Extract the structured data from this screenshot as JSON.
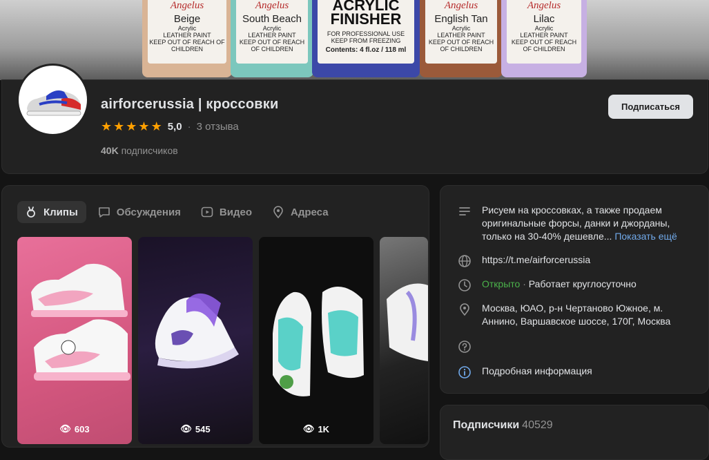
{
  "cover": {
    "bottles": [
      {
        "brand": "Angelus",
        "name": "Beige",
        "sub1": "Acrylic",
        "sub2": "LEATHER PAINT",
        "sub3": "KEEP OUT OF REACH OF CHILDREN",
        "color": "#d9b495"
      },
      {
        "brand": "Angelus",
        "name": "South Beach",
        "sub1": "Acrylic",
        "sub2": "LEATHER PAINT",
        "sub3": "KEEP OUT OF REACH OF CHILDREN",
        "color": "#7cc7bd"
      },
      {
        "brand": "",
        "name": "ACRYLIC FINISHER",
        "sub1": "FOR PROFESSIONAL USE",
        "sub2": "KEEP FROM FREEZING",
        "sub3": "Contents: 4 fl.oz / 118 ml",
        "color": "#3c48a8"
      },
      {
        "brand": "Angelus",
        "name": "English Tan",
        "sub1": "Acrylic",
        "sub2": "LEATHER PAINT",
        "sub3": "KEEP OUT OF REACH OF CHILDREN",
        "color": "#9b5a3a"
      },
      {
        "brand": "Angelus",
        "name": "Lilac",
        "sub1": "Acrylic",
        "sub2": "LEATHER PAINT",
        "sub3": "KEEP OUT OF REACH OF CHILDREN",
        "color": "#c7b0e3"
      }
    ]
  },
  "header": {
    "title": "airforcerussia | кроссовки",
    "rating_value": "5,0",
    "reviews": "3 отзыва",
    "subscribers_count": "40K",
    "subscribers_label": "подписчиков",
    "subscribe_button": "Подписаться",
    "stars": 5
  },
  "tabs": [
    {
      "label": "Клипы",
      "icon": "clips-icon",
      "active": true
    },
    {
      "label": "Обсуждения",
      "icon": "discussion-icon",
      "active": false
    },
    {
      "label": "Видео",
      "icon": "video-icon",
      "active": false
    },
    {
      "label": "Адреса",
      "icon": "location-icon",
      "active": false
    }
  ],
  "clips": [
    {
      "views": "603"
    },
    {
      "views": "545"
    },
    {
      "views": "1K"
    },
    {
      "views": ""
    }
  ],
  "info": {
    "description": "Рисуем на кроссовках, а также продаем оригинальные форсы, данки и джорданы, только на 30-40% дешевле...",
    "show_more": "Показать ещё",
    "url": "https://t.me/airforcerussia",
    "status_open": "Открыто",
    "status_hours": "Работает круглосуточно",
    "address": "Москва, ЮАО, р-н Чертаново Южное, м. Аннино, Варшавское шоссе, 170Г, Москва",
    "details": "Подробная информация"
  },
  "subscribers_section": {
    "title": "Подписчики",
    "count": "40529"
  },
  "colors": {
    "accent_link": "#71aaeb",
    "open_green": "#4bb34b",
    "star": "#ffa000",
    "background": "#141414",
    "card": "#222222"
  }
}
